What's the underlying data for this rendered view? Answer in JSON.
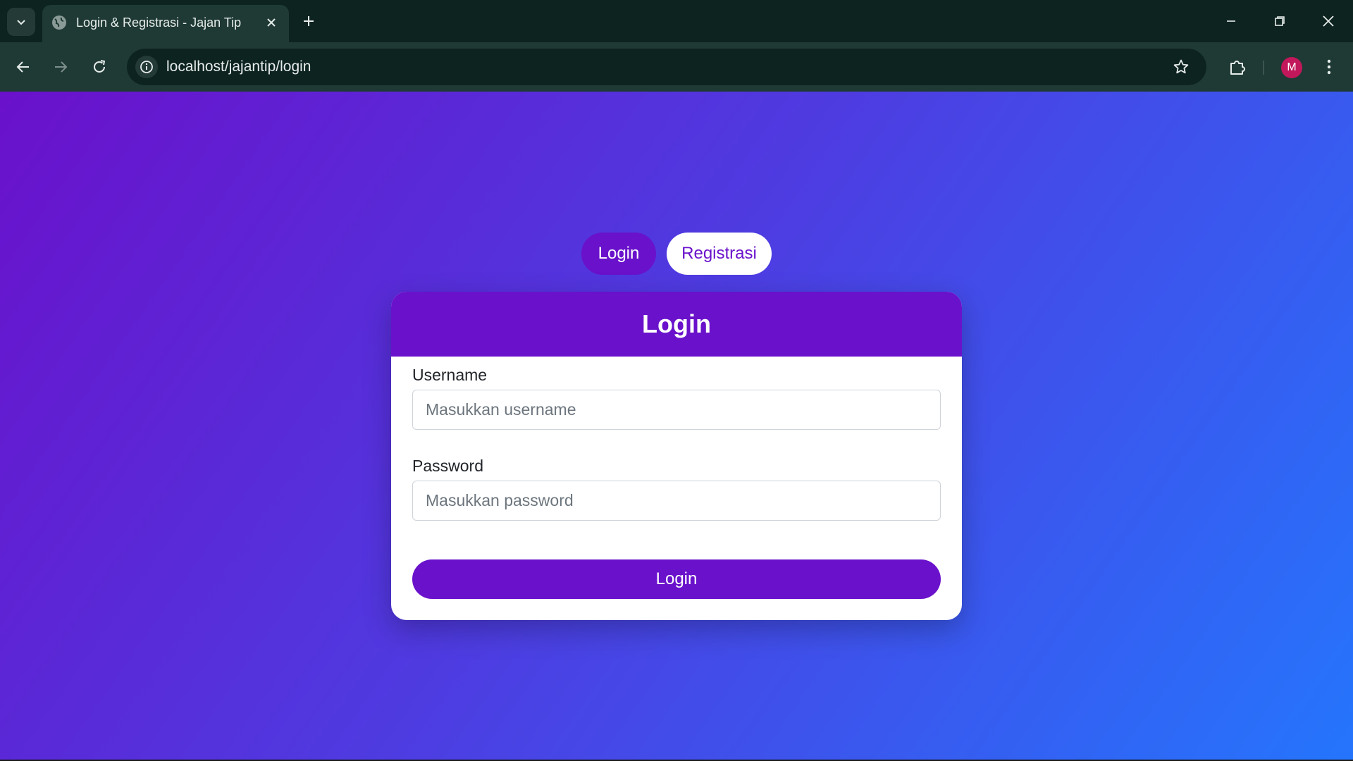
{
  "browser": {
    "tab_title": "Login & Registrasi - Jajan Tip",
    "url": "localhost/jajantip/login",
    "profile_initial": "M",
    "icons": {
      "tab_search": "chevron-down-icon",
      "tab_favicon": "globe-icon",
      "tab_close": "close-icon",
      "new_tab": "plus-icon",
      "minimize": "minimize-icon",
      "restore": "restore-icon",
      "close_window": "close-icon",
      "back": "arrow-left-icon",
      "forward": "arrow-right-icon",
      "reload": "reload-icon",
      "site_info": "info-icon",
      "bookmark": "star-icon",
      "extensions": "puzzle-icon",
      "menu": "kebab-icon"
    }
  },
  "page": {
    "switch": {
      "login_label": "Login",
      "register_label": "Registrasi"
    },
    "card": {
      "title": "Login",
      "username_label": "Username",
      "username_placeholder": "Masukkan username",
      "password_label": "Password",
      "password_placeholder": "Masukkan password",
      "submit_label": "Login"
    }
  },
  "colors": {
    "primary": "#6a11cb",
    "gradient_start": "#6a11cb",
    "gradient_end": "#2575fc",
    "chrome_dark": "#0d2320",
    "chrome_toolbar": "#1f3a35",
    "avatar": "#c2185b"
  }
}
